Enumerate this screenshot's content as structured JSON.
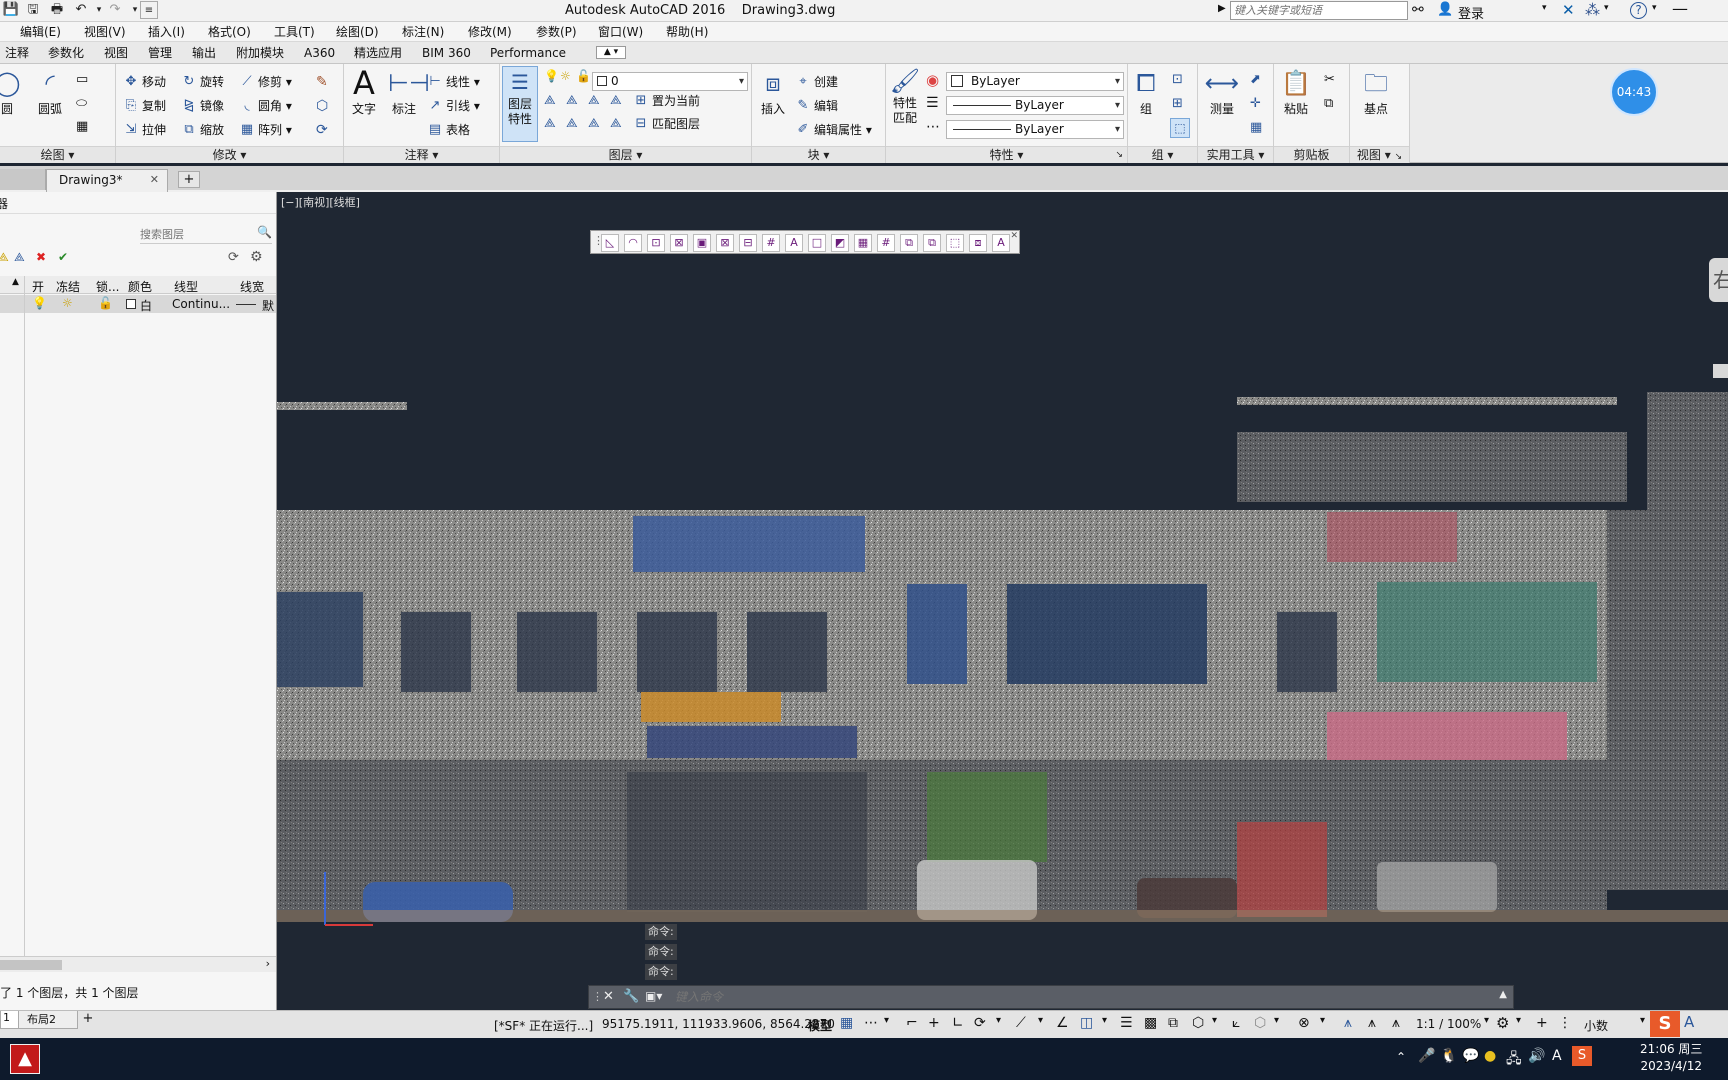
{
  "app": {
    "title": "Autodesk AutoCAD 2016",
    "document": "Drawing3.dwg",
    "search_placeholder": "键入关键字或短语",
    "login": "登录"
  },
  "menu": [
    "编辑(E)",
    "视图(V)",
    "插入(I)",
    "格式(O)",
    "工具(T)",
    "绘图(D)",
    "标注(N)",
    "修改(M)",
    "参数(P)",
    "窗口(W)",
    "帮助(H)"
  ],
  "ribbon_tabs": [
    "注释",
    "参数化",
    "视图",
    "管理",
    "输出",
    "附加模块",
    "A360",
    "精选应用",
    "BIM 360",
    "Performance"
  ],
  "ribbon": {
    "draw": {
      "circle": "圆",
      "arc": "圆弧",
      "label": "绘图"
    },
    "modify": {
      "move": "移动",
      "rotate": "旋转",
      "trim": "修剪",
      "copy": "复制",
      "mirror": "镜像",
      "fillet": "圆角",
      "stretch": "拉伸",
      "scale": "缩放",
      "array": "阵列",
      "label": "修改"
    },
    "annotation": {
      "text": "文字",
      "dimension": "标注",
      "linear": "线性",
      "leader": "引线",
      "table": "表格",
      "label": "注释"
    },
    "layers": {
      "props": "图层特性",
      "current_layer": "0",
      "set_current": "置为当前",
      "match": "匹配图层",
      "label": "图层"
    },
    "block": {
      "insert": "插入",
      "create": "创建",
      "edit": "编辑",
      "edit_attr": "编辑属性",
      "label": "块"
    },
    "properties": {
      "match": "特性匹配",
      "color": "ByLayer",
      "linetype": "ByLayer",
      "lineweight": "ByLayer",
      "label": "特性"
    },
    "groups": {
      "group": "组",
      "label": "组"
    },
    "utilities": {
      "measure": "测量",
      "label": "实用工具"
    },
    "clipboard": {
      "paste": "粘贴",
      "label": "剪贴板"
    },
    "view": {
      "base": "基点",
      "label": "视图"
    }
  },
  "timer": "04:43",
  "doc_tab": {
    "name": "Drawing3*"
  },
  "layer_panel": {
    "search_placeholder": "搜索图层",
    "columns": [
      "开",
      "冻结",
      "锁...",
      "颜色",
      "线型",
      "线宽"
    ],
    "row": {
      "color": "白",
      "linetype": "Continu...",
      "lineweight": "默"
    },
    "summary": "了 1 个图层，共 1 个图层",
    "layout_tab": "布局2",
    "layout_tab_prev": "1"
  },
  "viewport": {
    "label": "[−][南视][线框]",
    "side_text": "右",
    "command_history": [
      "命令:",
      "命令:",
      "命令:"
    ],
    "command_placeholder": "键入命令"
  },
  "status": {
    "running": "[*SF* 正在运行...]",
    "coords": "95175.1911, 111933.9606, 8564.2270",
    "model": "模型",
    "scale": "1:1 / 100%",
    "units": "小数"
  },
  "taskbar": {
    "time": "21:06 周三",
    "date": "2023/4/12",
    "ime": "A"
  }
}
